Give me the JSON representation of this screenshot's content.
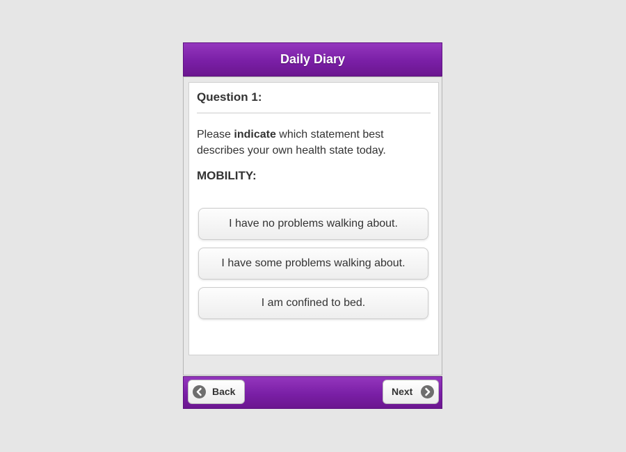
{
  "header": {
    "title": "Daily Diary"
  },
  "question": {
    "title": "Question 1:",
    "prompt_prefix": "Please ",
    "prompt_bold": "indicate",
    "prompt_suffix": " which statement best describes your own health state today.",
    "category": "MOBILITY:"
  },
  "options": [
    {
      "label": "I have no problems walking about."
    },
    {
      "label": "I have some problems walking about."
    },
    {
      "label": "I am confined to bed."
    }
  ],
  "footer": {
    "back_label": "Back",
    "back_icon": "arrow-left-circle-icon",
    "next_label": "Next",
    "next_icon": "arrow-right-circle-icon"
  },
  "colors": {
    "accent_purple": "#7a1fa6",
    "background": "#e6e6e6",
    "card": "#ffffff",
    "text": "#333333"
  }
}
